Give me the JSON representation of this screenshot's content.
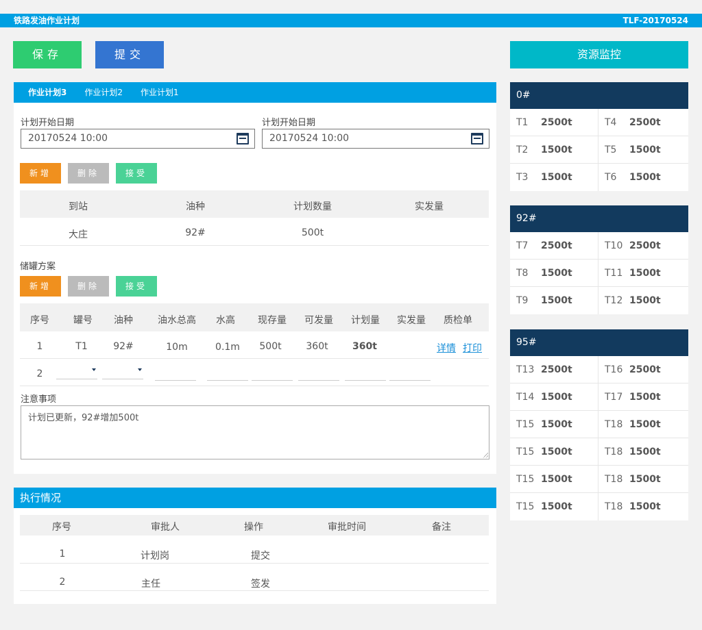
{
  "header": {
    "title": "铁路发油作业计划",
    "code": "TLF-20170524"
  },
  "toolbar": {
    "save_label": "保存",
    "submit_label": "提交",
    "monitor_label": "资源监控"
  },
  "plan": {
    "tabs": [
      {
        "label": "作业计划3",
        "active": true
      },
      {
        "label": "作业计划2"
      },
      {
        "label": "作业计划1"
      }
    ],
    "start_label": "计划开始日期",
    "start_value": "20170524 10:00",
    "end_label": "计划开始日期",
    "end_value": "20170524 10:00",
    "buttons": {
      "add": "新增",
      "delete": "删除",
      "accept": "接受"
    },
    "dest_table": {
      "headers": [
        "到站",
        "油种",
        "计划数量",
        "实发量"
      ],
      "rows": [
        [
          "大庄",
          "92#",
          "500t",
          ""
        ]
      ]
    },
    "tank_section_label": "储罐方案",
    "tank_table": {
      "headers": [
        "序号",
        "罐号",
        "油种",
        "油水总高",
        "水高",
        "现存量",
        "可发量",
        "计划量",
        "实发量",
        "质检单"
      ],
      "rows": [
        [
          "1",
          "T1",
          "92#",
          "10m",
          "0.1m",
          "500t",
          "360t",
          "360t",
          "",
          ""
        ]
      ],
      "detail_link": "详情",
      "print_link": "打印",
      "new_row_index": "2"
    },
    "notes_label": "注意事项",
    "notes_value": "计划已更新，92#增加500t"
  },
  "execution": {
    "title": "执行情况",
    "headers": [
      "序号",
      "审批人",
      "操作",
      "审批时间",
      "备注"
    ],
    "rows": [
      [
        "1",
        "计划岗",
        "提交",
        "",
        ""
      ],
      [
        "2",
        "主任",
        "签发",
        "",
        ""
      ]
    ]
  },
  "resources": [
    {
      "name": "0#",
      "rows": [
        [
          [
            "T1",
            "2500t"
          ],
          [
            "T4",
            "2500t"
          ]
        ],
        [
          [
            "T2",
            "1500t"
          ],
          [
            "T5",
            "1500t"
          ]
        ],
        [
          [
            "T3",
            "1500t"
          ],
          [
            "T6",
            "1500t"
          ]
        ]
      ]
    },
    {
      "name": "92#",
      "rows": [
        [
          [
            "T7",
            "2500t"
          ],
          [
            "T10",
            "2500t"
          ]
        ],
        [
          [
            "T8",
            "1500t"
          ],
          [
            "T11",
            "1500t"
          ]
        ],
        [
          [
            "T9",
            "1500t"
          ],
          [
            "T12",
            "1500t"
          ]
        ]
      ]
    },
    {
      "name": "95#",
      "rows": [
        [
          [
            "T13",
            "2500t"
          ],
          [
            "T16",
            "2500t"
          ]
        ],
        [
          [
            "T14",
            "1500t"
          ],
          [
            "T17",
            "1500t"
          ]
        ],
        [
          [
            "T15",
            "1500t"
          ],
          [
            "T18",
            "1500t"
          ]
        ],
        [
          [
            "T15",
            "1500t"
          ],
          [
            "T18",
            "1500t"
          ]
        ],
        [
          [
            "T15",
            "1500t"
          ],
          [
            "T18",
            "1500t"
          ]
        ],
        [
          [
            "T15",
            "1500t"
          ],
          [
            "T18",
            "1500t"
          ]
        ]
      ]
    }
  ],
  "colors": {
    "accent": "#00a0e2",
    "navy": "#123a5e",
    "orange": "#f0901e",
    "green": "#4ad296",
    "save": "#2ecc71",
    "submit": "#3475d1",
    "teal": "#00b8c8"
  }
}
